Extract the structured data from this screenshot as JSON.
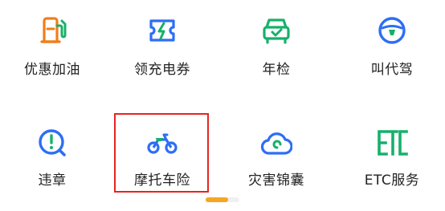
{
  "services": {
    "row1": [
      {
        "label": "优惠加油",
        "icon": "fuel-pump-icon"
      },
      {
        "label": "领充电券",
        "icon": "charging-coupon-icon"
      },
      {
        "label": "年检",
        "icon": "car-check-icon"
      },
      {
        "label": "叫代驾",
        "icon": "steering-wheel-icon"
      }
    ],
    "row2": [
      {
        "label": "违章",
        "icon": "violation-search-icon"
      },
      {
        "label": "摩托车险",
        "icon": "motorcycle-icon"
      },
      {
        "label": "灾害锦囊",
        "icon": "disaster-tips-icon"
      },
      {
        "label": "ETC服务",
        "icon": "etc-icon"
      }
    ]
  },
  "colors": {
    "icon_orange": "#f07d1b",
    "icon_blue": "#2d6ef5",
    "icon_green": "#17b06b",
    "highlight_red": "#e8231f",
    "pager_active": "#f5a623"
  },
  "pager": {
    "pages": 2,
    "current": 1
  }
}
